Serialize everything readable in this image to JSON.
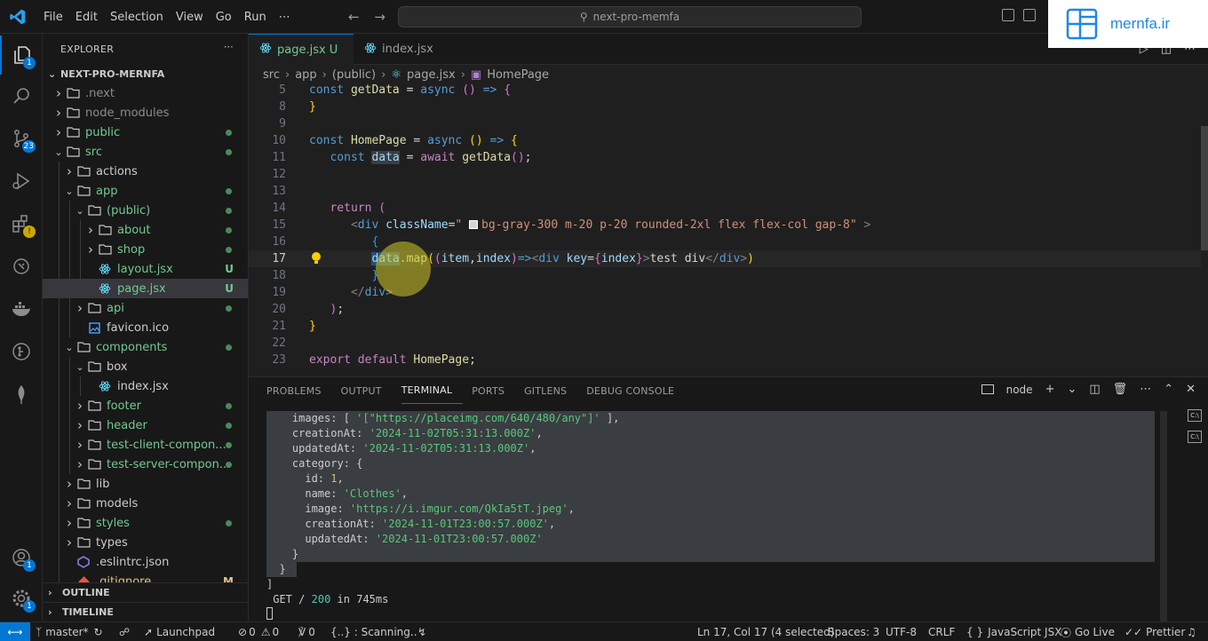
{
  "titlebar": {
    "menu": [
      "File",
      "Edit",
      "Selection",
      "View",
      "Go",
      "Run",
      "⋯"
    ],
    "search": "next-pro-memfa"
  },
  "watermark": {
    "text": "mernfa.ir"
  },
  "activity": {
    "explorer_badge": "1",
    "scm_badge": "23",
    "extensions_badge": "!",
    "accounts_badge": "1",
    "settings_badge": "1"
  },
  "sidebar": {
    "title": "EXPLORER",
    "project": "NEXT-PRO-MERNFA",
    "tree": [
      {
        "label": ".next",
        "indent": 1,
        "type": "folder",
        "open": false,
        "color": "gray",
        "status": ""
      },
      {
        "label": "node_modules",
        "indent": 1,
        "type": "folder",
        "open": false,
        "color": "gray",
        "status": ""
      },
      {
        "label": "public",
        "indent": 1,
        "type": "folder",
        "open": false,
        "color": "green",
        "status": "dot"
      },
      {
        "label": "src",
        "indent": 1,
        "type": "folder",
        "open": true,
        "color": "green",
        "status": "dot"
      },
      {
        "label": "actions",
        "indent": 2,
        "type": "folder",
        "open": false,
        "color": "white",
        "status": ""
      },
      {
        "label": "app",
        "indent": 2,
        "type": "folder",
        "open": true,
        "color": "green",
        "status": "dot"
      },
      {
        "label": "(public)",
        "indent": 3,
        "type": "folder",
        "open": true,
        "color": "green",
        "status": "dot"
      },
      {
        "label": "about",
        "indent": 4,
        "type": "folder",
        "open": false,
        "color": "green",
        "status": "dot"
      },
      {
        "label": "shop",
        "indent": 4,
        "type": "folder",
        "open": false,
        "color": "green",
        "status": "dot"
      },
      {
        "label": "layout.jsx",
        "indent": 4,
        "type": "react",
        "open": false,
        "color": "green",
        "status": "U"
      },
      {
        "label": "page.jsx",
        "indent": 4,
        "type": "react",
        "open": false,
        "color": "green",
        "status": "U",
        "selected": true
      },
      {
        "label": "api",
        "indent": 3,
        "type": "folder",
        "open": false,
        "color": "green",
        "status": "dot"
      },
      {
        "label": "favicon.ico",
        "indent": 3,
        "type": "image",
        "open": false,
        "color": "white",
        "status": ""
      },
      {
        "label": "components",
        "indent": 2,
        "type": "folder",
        "open": true,
        "color": "green",
        "status": "dot"
      },
      {
        "label": "box",
        "indent": 3,
        "type": "folder",
        "open": true,
        "color": "white",
        "status": ""
      },
      {
        "label": "index.jsx",
        "indent": 4,
        "type": "react",
        "open": false,
        "color": "white",
        "status": ""
      },
      {
        "label": "footer",
        "indent": 3,
        "type": "folder",
        "open": false,
        "color": "green",
        "status": "dot"
      },
      {
        "label": "header",
        "indent": 3,
        "type": "folder",
        "open": false,
        "color": "green",
        "status": "dot"
      },
      {
        "label": "test-client-compon...",
        "indent": 3,
        "type": "folder",
        "open": false,
        "color": "green",
        "status": "dot"
      },
      {
        "label": "test-server-compon...",
        "indent": 3,
        "type": "folder",
        "open": false,
        "color": "green",
        "status": "dot"
      },
      {
        "label": "lib",
        "indent": 2,
        "type": "folder",
        "open": false,
        "color": "white",
        "status": ""
      },
      {
        "label": "models",
        "indent": 2,
        "type": "folder",
        "open": false,
        "color": "white",
        "status": ""
      },
      {
        "label": "styles",
        "indent": 2,
        "type": "folder",
        "open": false,
        "color": "green",
        "status": "dot"
      },
      {
        "label": "types",
        "indent": 2,
        "type": "folder",
        "open": false,
        "color": "white",
        "status": ""
      },
      {
        "label": ".eslintrc.json",
        "indent": 2,
        "type": "eslint",
        "open": false,
        "color": "white",
        "status": ""
      },
      {
        "label": ".gitignore",
        "indent": 2,
        "type": "git",
        "open": false,
        "color": "orange",
        "status": "M"
      }
    ],
    "outline": "OUTLINE",
    "timeline": "TIMELINE"
  },
  "tabs": [
    {
      "label": "page.jsx",
      "modified": "U",
      "active": true
    },
    {
      "label": "index.jsx",
      "modified": "",
      "active": false
    }
  ],
  "breadcrumb": [
    "src",
    "app",
    "(public)",
    "page.jsx",
    "HomePage"
  ],
  "code": {
    "line_numbers": [
      "5",
      "8",
      "9",
      "10",
      "11",
      "12",
      "13",
      "14",
      "15",
      "16",
      "17",
      "18",
      "19",
      "20",
      "21",
      "22",
      "23"
    ],
    "current_line": "17"
  },
  "panel": {
    "tabs": [
      "PROBLEMS",
      "OUTPUT",
      "TERMINAL",
      "PORTS",
      "GITLENS",
      "DEBUG CONSOLE"
    ],
    "active_tab": "TERMINAL",
    "shell": "node"
  },
  "terminal": {
    "images_key": "images",
    "images_value": "'[\"https://placeimg.com/640/480/any\"]'",
    "creationAt_outer": "'2024-11-02T05:31:13.000Z'",
    "updatedAt_outer": "'2024-11-02T05:31:13.000Z'",
    "category_id": "1",
    "category_name": "'Clothes'",
    "category_image": "'https://i.imgur.com/QkIa5tT.jpeg'",
    "category_creationAt": "'2024-11-01T23:00:57.000Z'",
    "category_updatedAt": "'2024-11-01T23:00:57.000Z'",
    "request_method": "GET",
    "request_path": "/",
    "request_status": "200",
    "request_time": "in 745ms"
  },
  "statusbar": {
    "branch": "master*",
    "launchpad": "Launchpad",
    "errors": "0",
    "warnings": "0",
    "ports": "0",
    "scanning": "{..} : Scanning..",
    "position": "Ln 17, Col 17 (4 selected)",
    "spaces": "Spaces: 3",
    "encoding": "UTF-8",
    "eol": "CRLF",
    "language": "JavaScript JSX",
    "golive": "Go Live",
    "prettier": "Prettier"
  }
}
